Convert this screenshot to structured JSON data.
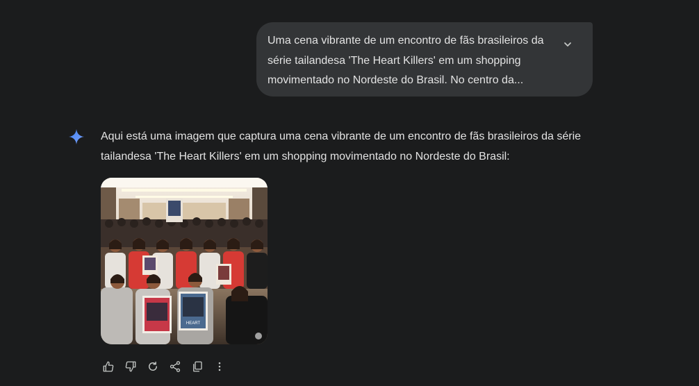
{
  "user_prompt": {
    "text": "Uma cena vibrante de um encontro de fãs brasileiros da série tailandesa 'The Heart Killers' em um shopping movimentado no Nordeste do Brasil. No centro da..."
  },
  "response": {
    "text": "Aqui está uma imagem que captura uma cena vibrante de um encontro de fãs brasileiros da série tailandesa 'The Heart Killers' em um shopping movimentado no Nordeste do Brasil:"
  },
  "icons": {
    "expand": "chevron-down-icon",
    "assistant": "sparkle-icon",
    "actions": [
      "thumbs-up-icon",
      "thumbs-down-icon",
      "regenerate-icon",
      "share-icon",
      "copy-icon",
      "more-vert-icon"
    ]
  },
  "colors": {
    "background": "#1b1c1d",
    "bubble": "#333537",
    "text": "#e3e3e3",
    "icon": "#c4c7c5",
    "sparkle": "#4285f4"
  }
}
